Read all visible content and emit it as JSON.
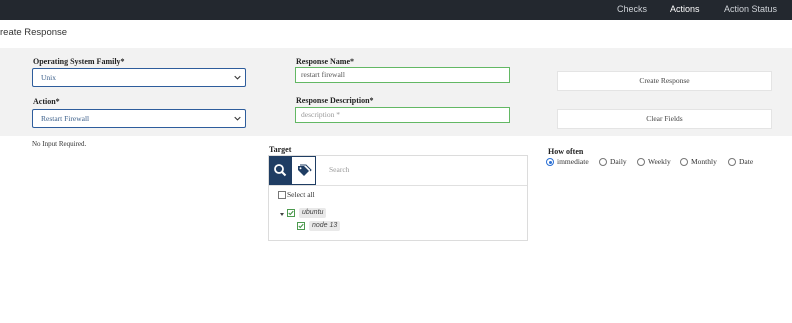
{
  "nav": {
    "checks": "Checks",
    "actions": "Actions",
    "action_status": "Action Status"
  },
  "page": {
    "title": "reate Response"
  },
  "form": {
    "os_family": {
      "label": "Operating System Family*",
      "value": "Unix"
    },
    "action": {
      "label": "Action*",
      "value": "Restart Firewall"
    },
    "response_name": {
      "label": "Response Name*",
      "value": "restart firewall"
    },
    "response_description": {
      "label": "Response Description*",
      "placeholder": "description *"
    },
    "create_button": "Create Response",
    "clear_button": "Clear Fields",
    "no_input": "No Input Required."
  },
  "target": {
    "label": "Target",
    "search_placeholder": "Search",
    "select_all": "Select all",
    "tree": [
      {
        "label": "ubuntu",
        "checked": true
      },
      {
        "label": "node 13",
        "checked": true
      }
    ]
  },
  "how_often": {
    "label": "How often",
    "options": [
      "immediate",
      "Daily",
      "Weekly",
      "Monthly",
      "Date"
    ],
    "selected": "immediate"
  },
  "colors": {
    "topbar": "#23282f",
    "primary": "#1f3d63",
    "valid_border": "#63b864",
    "radio_accent": "#2a6fd4"
  }
}
